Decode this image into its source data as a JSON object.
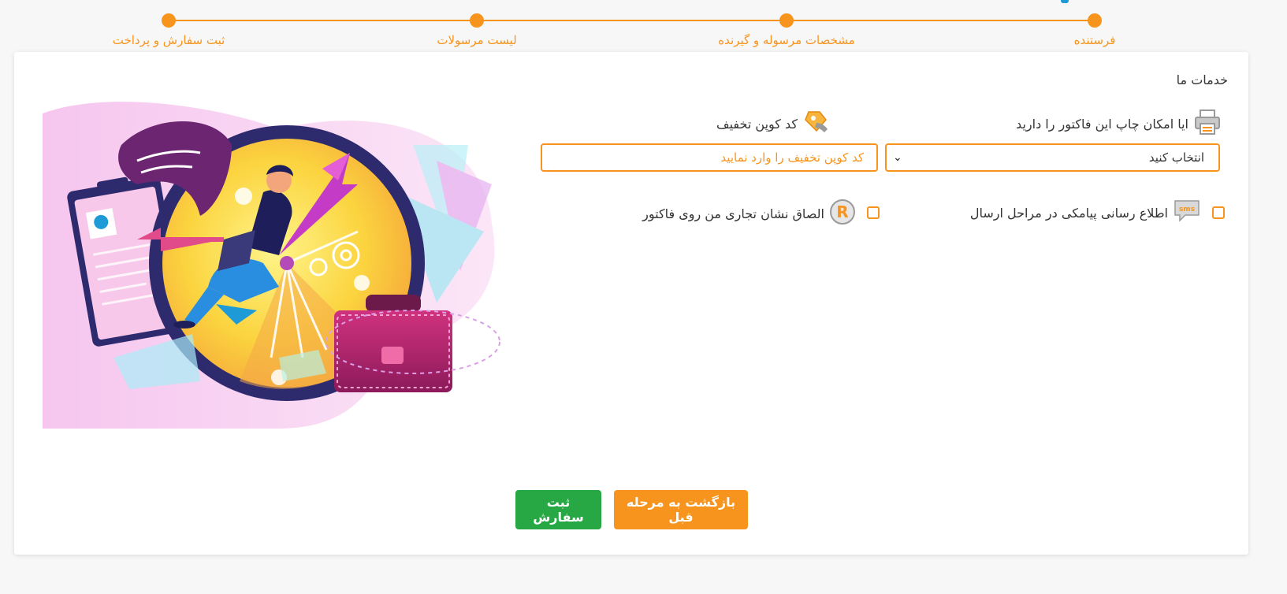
{
  "stepper": {
    "steps": [
      {
        "label": "فرستنده"
      },
      {
        "label": "مشخصات مرسوله و گیرنده"
      },
      {
        "label": "لیست مرسولات"
      },
      {
        "label": "ثبت سفارش و پرداخت"
      }
    ],
    "accent": "#f7941d"
  },
  "services": {
    "title": "خدمات ما",
    "print_invoice": {
      "label": "ایا امکان چاپ این فاکتور را دارید",
      "icon": "printer-icon",
      "selected_value": "انتخاب کنید"
    },
    "coupon": {
      "label": "کد کوپن تخفیف",
      "icon": "coupon-icon",
      "placeholder": "کد کوپن تخفیف را وارد نمایید"
    },
    "sms_notify": {
      "label": "اطلاع رسانی پیامکی در مراحل ارسال",
      "icon": "sms-icon",
      "checked": false
    },
    "trademark": {
      "label": "الصاق نشان تجاری من روی فاکتور",
      "icon": "registered-trademark-icon",
      "checked": false
    }
  },
  "actions": {
    "back_label": "بازگشت به مرحله قبل",
    "submit_label": "ثبت سفارش",
    "back_color": "#f7941d",
    "submit_color": "#27a844"
  }
}
